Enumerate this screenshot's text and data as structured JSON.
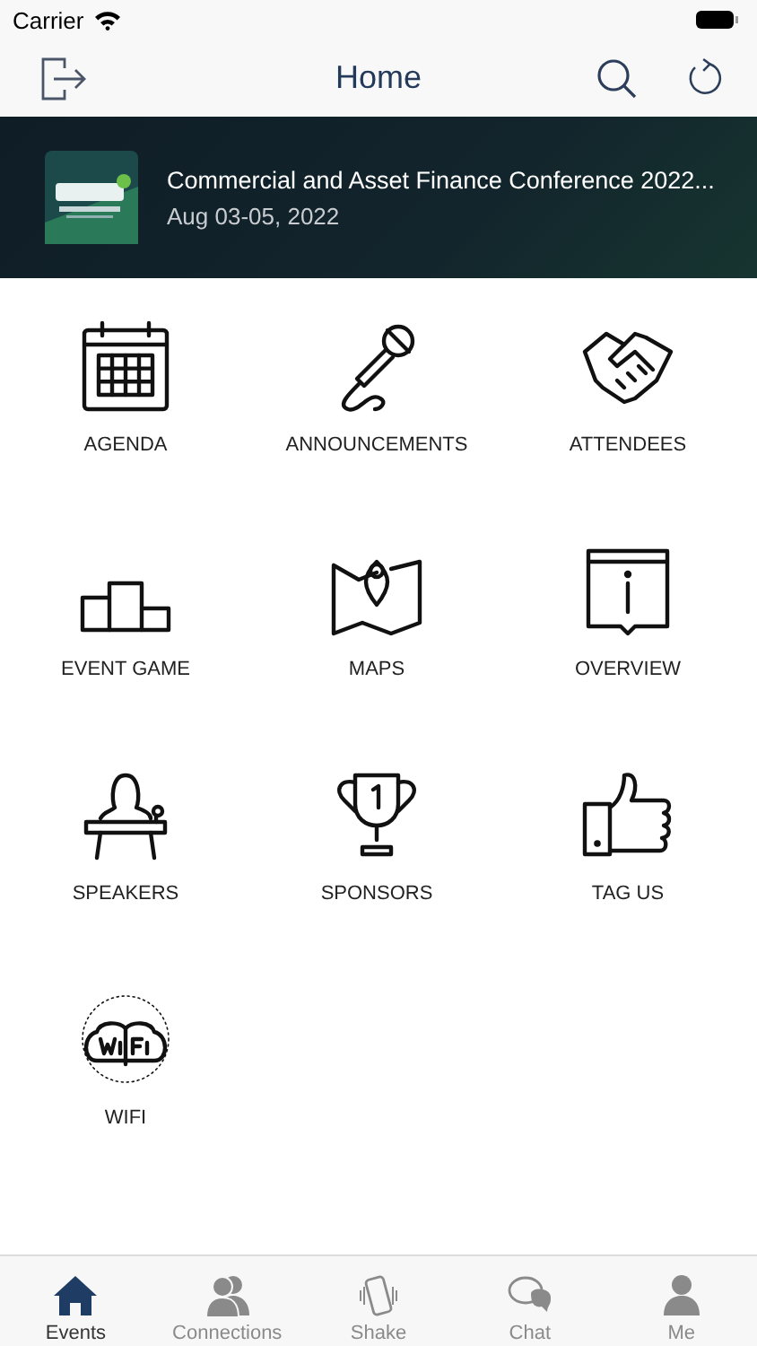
{
  "status_bar": {
    "carrier": "Carrier"
  },
  "nav_bar": {
    "title": "Home"
  },
  "event": {
    "title": "Commercial and Asset Finance Conference 2022...",
    "dates": "Aug 03-05, 2022"
  },
  "tiles": [
    {
      "kind": "calendar",
      "label": "AGENDA"
    },
    {
      "kind": "microphone",
      "label": "ANNOUNCEMENTS"
    },
    {
      "kind": "handshake",
      "label": "ATTENDEES"
    },
    {
      "kind": "podium",
      "label": "EVENT GAME"
    },
    {
      "kind": "map",
      "label": "MAPS"
    },
    {
      "kind": "info",
      "label": "OVERVIEW"
    },
    {
      "kind": "speaker",
      "label": "SPEAKERS"
    },
    {
      "kind": "trophy",
      "label": "SPONSORS"
    },
    {
      "kind": "thumbs-up",
      "label": "TAG US"
    },
    {
      "kind": "wifi",
      "label": "WIFI"
    }
  ],
  "tab_bar": [
    {
      "kind": "home",
      "label": "Events",
      "selected": true
    },
    {
      "kind": "people",
      "label": "Connections",
      "selected": false
    },
    {
      "kind": "phone",
      "label": "Shake",
      "selected": false
    },
    {
      "kind": "chat",
      "label": "Chat",
      "selected": false
    },
    {
      "kind": "person",
      "label": "Me",
      "selected": false
    }
  ]
}
